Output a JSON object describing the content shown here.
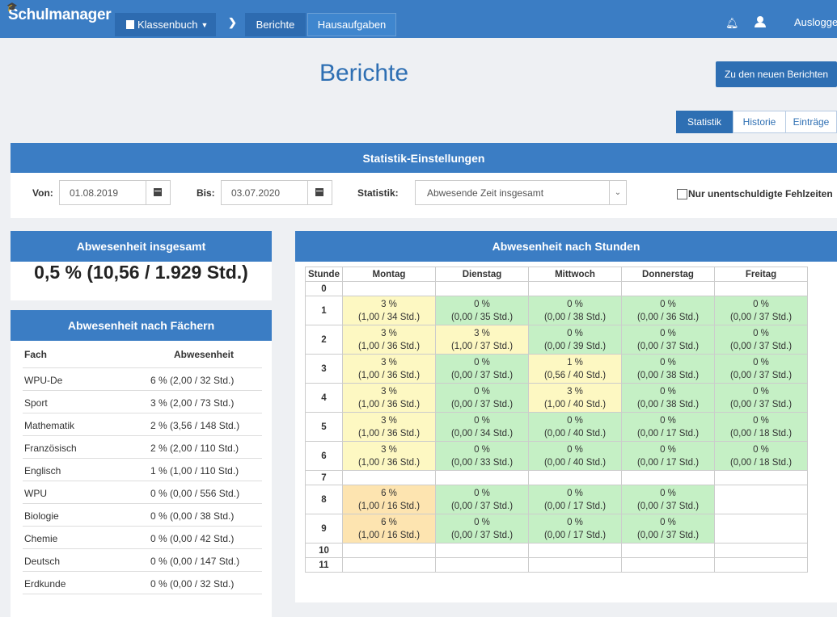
{
  "nav": {
    "brand": "Schulmanager",
    "klassenbuch": "Klassenbuch",
    "tabs": [
      "Berichte",
      "Hausaufgaben"
    ],
    "logout": "Ausloggen"
  },
  "page": {
    "title": "Berichte",
    "new_reports_button": "Zu den neuen Berichten",
    "view_tabs": [
      "Statistik",
      "Historie",
      "Einträge"
    ]
  },
  "settings": {
    "title": "Statistik-Einstellungen",
    "von_label": "Von:",
    "von_value": "01.08.2019",
    "bis_label": "Bis:",
    "bis_value": "03.07.2020",
    "statistik_label": "Statistik:",
    "statistik_value": "Abwesende Zeit insgesamt",
    "only_unexcused_label": "Nur unentschuldigte Fehlzeiten"
  },
  "total": {
    "title": "Abwesenheit insgesamt",
    "value": "0,5 % (10,56 / 1.929 Std.)"
  },
  "subjects": {
    "title": "Abwesenheit nach Fächern",
    "col_fach": "Fach",
    "col_abwesenheit": "Abwesenheit",
    "rows": [
      {
        "name": "WPU-De",
        "value": "6 % (2,00 / 32 Std.)"
      },
      {
        "name": "Sport",
        "value": "3 % (2,00 / 73 Std.)"
      },
      {
        "name": "Mathematik",
        "value": "2 % (3,56 / 148 Std.)"
      },
      {
        "name": "Französisch",
        "value": "2 % (2,00 / 110 Std.)"
      },
      {
        "name": "Englisch",
        "value": "1 % (1,00 / 110 Std.)"
      },
      {
        "name": "WPU",
        "value": "0 % (0,00 / 556 Std.)"
      },
      {
        "name": "Biologie",
        "value": "0 % (0,00 / 38 Std.)"
      },
      {
        "name": "Chemie",
        "value": "0 % (0,00 / 42 Std.)"
      },
      {
        "name": "Deutsch",
        "value": "0 % (0,00 / 147 Std.)"
      },
      {
        "name": "Erdkunde",
        "value": "0 % (0,00 / 32 Std.)"
      }
    ]
  },
  "hours": {
    "title": "Abwesenheit nach Stunden",
    "headers": [
      "Stunde",
      "Montag",
      "Dienstag",
      "Mittwoch",
      "Donnerstag",
      "Freitag"
    ],
    "rows": [
      {
        "hour": "0",
        "cells": [
          null,
          null,
          null,
          null,
          null
        ]
      },
      {
        "hour": "1",
        "cells": [
          {
            "pct": "3 %",
            "detail": "(1,00 / 34 Std.)",
            "level": "y"
          },
          {
            "pct": "0 %",
            "detail": "(0,00 / 35 Std.)",
            "level": "g"
          },
          {
            "pct": "0 %",
            "detail": "(0,00 / 38 Std.)",
            "level": "g"
          },
          {
            "pct": "0 %",
            "detail": "(0,00 / 36 Std.)",
            "level": "g"
          },
          {
            "pct": "0 %",
            "detail": "(0,00 / 37 Std.)",
            "level": "g"
          }
        ]
      },
      {
        "hour": "2",
        "cells": [
          {
            "pct": "3 %",
            "detail": "(1,00 / 36 Std.)",
            "level": "y"
          },
          {
            "pct": "3 %",
            "detail": "(1,00 / 37 Std.)",
            "level": "y"
          },
          {
            "pct": "0 %",
            "detail": "(0,00 / 39 Std.)",
            "level": "g"
          },
          {
            "pct": "0 %",
            "detail": "(0,00 / 37 Std.)",
            "level": "g"
          },
          {
            "pct": "0 %",
            "detail": "(0,00 / 37 Std.)",
            "level": "g"
          }
        ]
      },
      {
        "hour": "3",
        "cells": [
          {
            "pct": "3 %",
            "detail": "(1,00 / 36 Std.)",
            "level": "y"
          },
          {
            "pct": "0 %",
            "detail": "(0,00 / 37 Std.)",
            "level": "g"
          },
          {
            "pct": "1 %",
            "detail": "(0,56 / 40 Std.)",
            "level": "y"
          },
          {
            "pct": "0 %",
            "detail": "(0,00 / 38 Std.)",
            "level": "g"
          },
          {
            "pct": "0 %",
            "detail": "(0,00 / 37 Std.)",
            "level": "g"
          }
        ]
      },
      {
        "hour": "4",
        "cells": [
          {
            "pct": "3 %",
            "detail": "(1,00 / 36 Std.)",
            "level": "y"
          },
          {
            "pct": "0 %",
            "detail": "(0,00 / 37 Std.)",
            "level": "g"
          },
          {
            "pct": "3 %",
            "detail": "(1,00 / 40 Std.)",
            "level": "y"
          },
          {
            "pct": "0 %",
            "detail": "(0,00 / 38 Std.)",
            "level": "g"
          },
          {
            "pct": "0 %",
            "detail": "(0,00 / 37 Std.)",
            "level": "g"
          }
        ]
      },
      {
        "hour": "5",
        "cells": [
          {
            "pct": "3 %",
            "detail": "(1,00 / 36 Std.)",
            "level": "y"
          },
          {
            "pct": "0 %",
            "detail": "(0,00 / 34 Std.)",
            "level": "g"
          },
          {
            "pct": "0 %",
            "detail": "(0,00 / 40 Std.)",
            "level": "g"
          },
          {
            "pct": "0 %",
            "detail": "(0,00 / 17 Std.)",
            "level": "g"
          },
          {
            "pct": "0 %",
            "detail": "(0,00 / 18 Std.)",
            "level": "g"
          }
        ]
      },
      {
        "hour": "6",
        "cells": [
          {
            "pct": "3 %",
            "detail": "(1,00 / 36 Std.)",
            "level": "y"
          },
          {
            "pct": "0 %",
            "detail": "(0,00 / 33 Std.)",
            "level": "g"
          },
          {
            "pct": "0 %",
            "detail": "(0,00 / 40 Std.)",
            "level": "g"
          },
          {
            "pct": "0 %",
            "detail": "(0,00 / 17 Std.)",
            "level": "g"
          },
          {
            "pct": "0 %",
            "detail": "(0,00 / 18 Std.)",
            "level": "g"
          }
        ]
      },
      {
        "hour": "7",
        "cells": [
          null,
          null,
          null,
          null,
          null
        ]
      },
      {
        "hour": "8",
        "cells": [
          {
            "pct": "6 %",
            "detail": "(1,00 / 16 Std.)",
            "level": "o"
          },
          {
            "pct": "0 %",
            "detail": "(0,00 / 37 Std.)",
            "level": "g"
          },
          {
            "pct": "0 %",
            "detail": "(0,00 / 17 Std.)",
            "level": "g"
          },
          {
            "pct": "0 %",
            "detail": "(0,00 / 37 Std.)",
            "level": "g"
          },
          null
        ]
      },
      {
        "hour": "9",
        "cells": [
          {
            "pct": "6 %",
            "detail": "(1,00 / 16 Std.)",
            "level": "o"
          },
          {
            "pct": "0 %",
            "detail": "(0,00 / 37 Std.)",
            "level": "g"
          },
          {
            "pct": "0 %",
            "detail": "(0,00 / 17 Std.)",
            "level": "g"
          },
          {
            "pct": "0 %",
            "detail": "(0,00 / 37 Std.)",
            "level": "g"
          },
          null
        ]
      },
      {
        "hour": "10",
        "cells": [
          null,
          null,
          null,
          null,
          null
        ]
      },
      {
        "hour": "11",
        "cells": [
          null,
          null,
          null,
          null,
          null
        ]
      }
    ]
  }
}
